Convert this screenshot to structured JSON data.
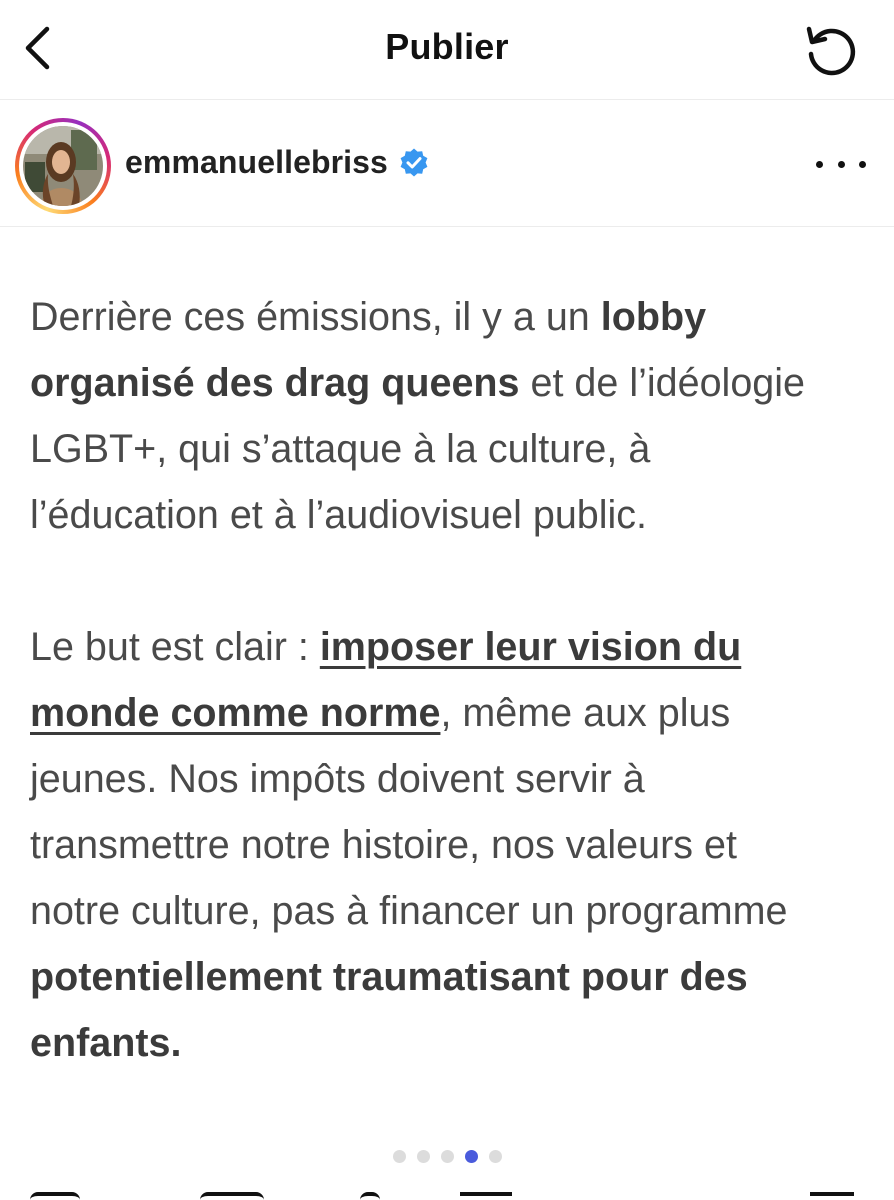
{
  "nav": {
    "title": "Publier",
    "back_icon": "chevron-left-icon",
    "refresh_icon": "refresh-icon"
  },
  "post": {
    "username": "emmanuellebriss",
    "verified": true,
    "verified_color": "#3897f0",
    "more_icon": "more-horizontal-icon"
  },
  "body": {
    "p1_l1_a": "Derrière ces émissions, il y a un ",
    "p1_l1_b": "lobby",
    "p1_l2_a": "organisé des drag queens",
    "p1_l2_b": " et de l’idéologie",
    "p1_l3": "LGBT+, qui s’attaque à la culture, à",
    "p1_l4": "l’éducation et à l’audiovisuel public.",
    "p2_l1_a": "Le but est clair : ",
    "p2_l1_b": "imposer leur vision du",
    "p2_l2_a": "monde comme norme",
    "p2_l2_b": ", même aux plus",
    "p2_l3": "jeunes. Nos impôts doivent servir à",
    "p2_l4": "transmettre notre histoire, nos valeurs et",
    "p2_l5": "notre culture, pas à financer un programme",
    "p2_l6": "potentiellement traumatisant pour des",
    "p2_l7": "enfants."
  },
  "carousel": {
    "total": 5,
    "active_index": 3,
    "active_color": "#4a5bdc"
  }
}
